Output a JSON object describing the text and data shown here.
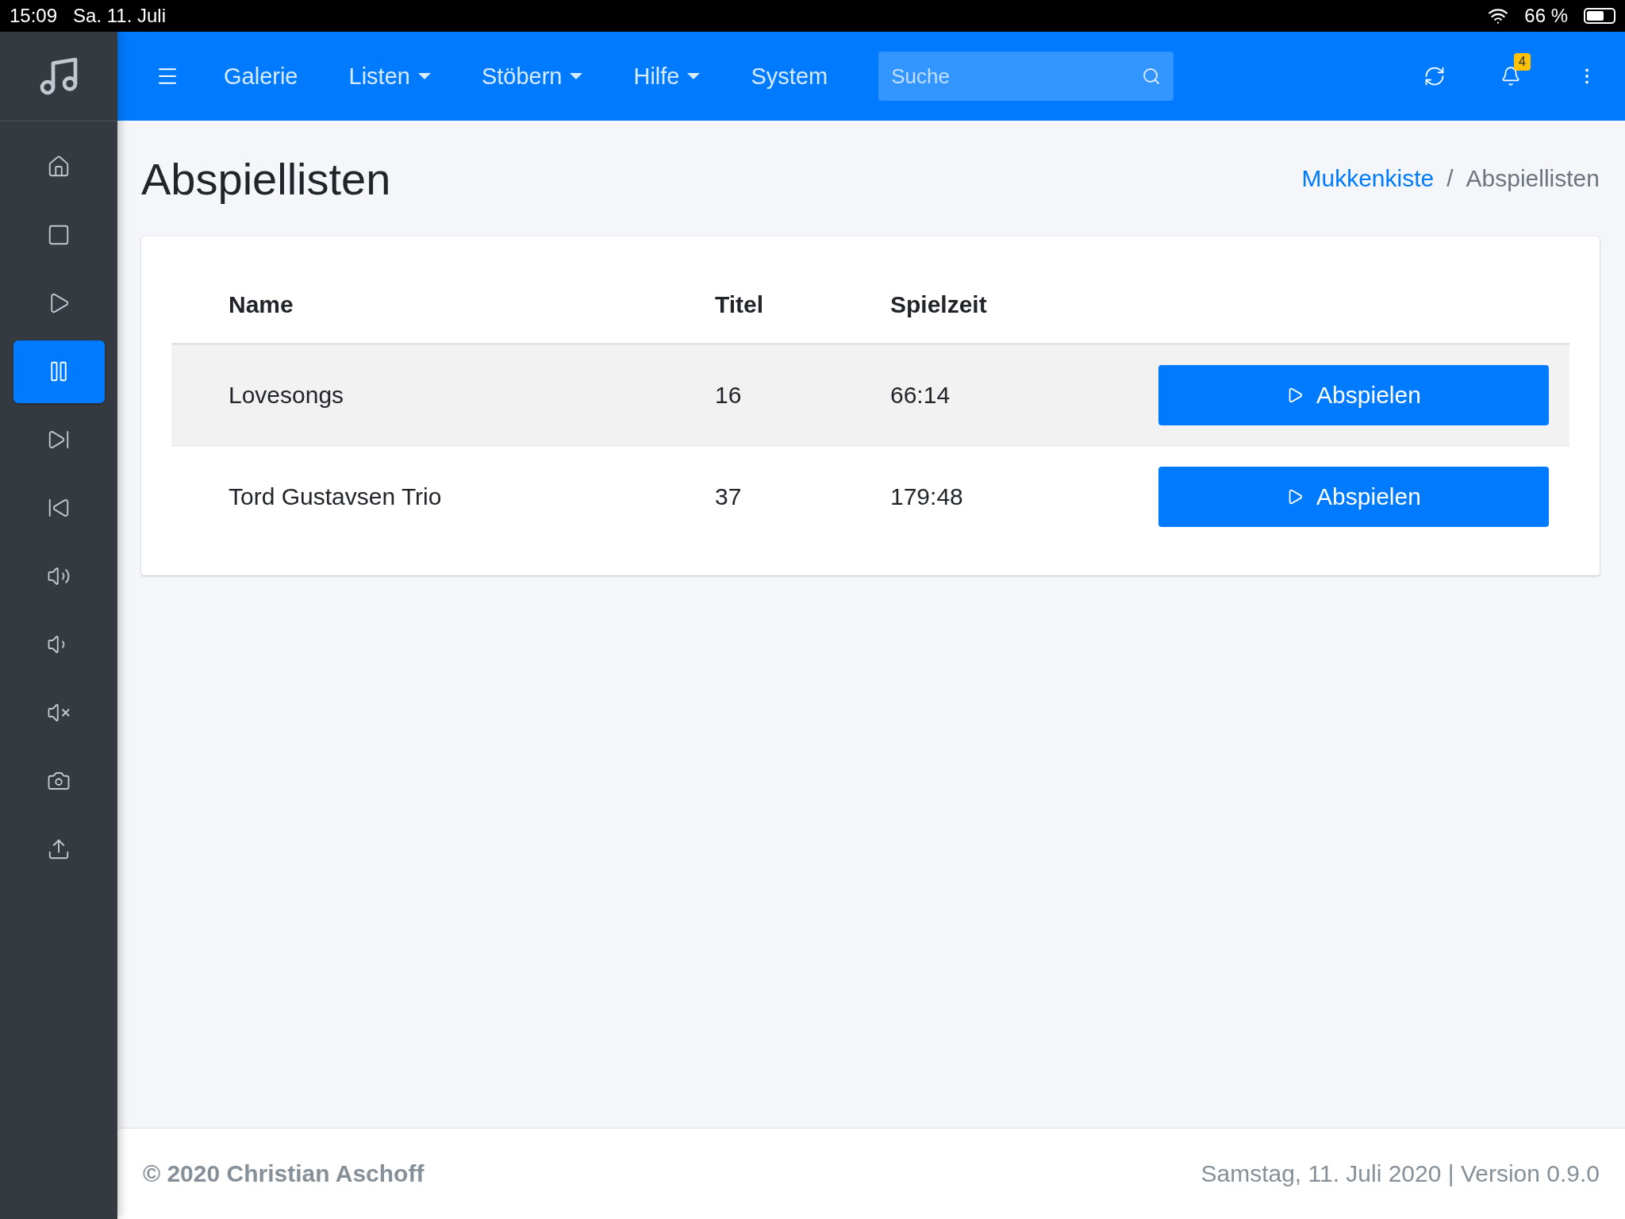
{
  "status_bar": {
    "time": "15:09",
    "date": "Sa. 11. Juli",
    "battery": "66 %"
  },
  "sidebar": {
    "items": [
      {
        "kind": "home",
        "selected": false
      },
      {
        "kind": "stop",
        "selected": false
      },
      {
        "kind": "play",
        "selected": false
      },
      {
        "kind": "pause",
        "selected": true
      },
      {
        "kind": "next",
        "selected": false
      },
      {
        "kind": "previous",
        "selected": false
      },
      {
        "kind": "volume-up",
        "selected": false
      },
      {
        "kind": "volume-down",
        "selected": false
      },
      {
        "kind": "mute",
        "selected": false
      },
      {
        "kind": "camera",
        "selected": false
      },
      {
        "kind": "upload",
        "selected": false
      }
    ]
  },
  "navbar": {
    "menu": [
      {
        "label": "Galerie",
        "dropdown": false
      },
      {
        "label": "Listen",
        "dropdown": true
      },
      {
        "label": "Stöbern",
        "dropdown": true
      },
      {
        "label": "Hilfe",
        "dropdown": true
      },
      {
        "label": "System",
        "dropdown": false
      }
    ],
    "search": {
      "placeholder": "Suche"
    },
    "notifications": "4"
  },
  "page": {
    "title": "Abspiellisten",
    "separator": "/",
    "breadcrumb": [
      {
        "label": "Mukkenkiste",
        "link": true
      },
      {
        "label": "Abspiellisten",
        "link": false
      }
    ]
  },
  "table": {
    "columns": [
      "Name",
      "Titel",
      "Spielzeit"
    ],
    "rows": [
      {
        "name": "Lovesongs",
        "titel": "16",
        "spielzeit": "66:14",
        "button": "Abspielen",
        "highlighted": true
      },
      {
        "name": "Tord Gustavsen Trio",
        "titel": "37",
        "spielzeit": "179:48",
        "button": "Abspielen",
        "highlighted": false
      }
    ]
  },
  "footer": {
    "copyright": "© 2020 Christian Aschoff",
    "info": "Samstag, 11. Juli 2020 | Version 0.9.0"
  }
}
